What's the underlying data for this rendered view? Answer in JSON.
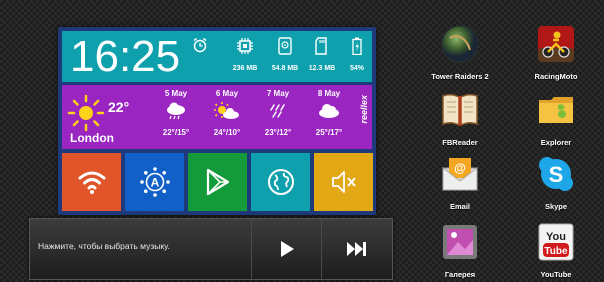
{
  "clock": {
    "time": "16:25"
  },
  "stats": [
    {
      "icon": "cpu-icon",
      "value": "236 MB"
    },
    {
      "icon": "sd-card-icon",
      "value": "54.8 MB"
    },
    {
      "icon": "memory-card-icon",
      "value": "12.3 MB"
    },
    {
      "icon": "battery-icon",
      "value": "54%"
    }
  ],
  "weather": {
    "current_temp": "22°",
    "city": "London",
    "brand": "reellex",
    "days": [
      {
        "date": "5 May",
        "range": "22°/15°",
        "icon": "cloud-rain-icon"
      },
      {
        "date": "6 May",
        "range": "24°/10°",
        "icon": "sun-cloud-icon"
      },
      {
        "date": "7 May",
        "range": "23°/12°",
        "icon": "rain-icon"
      },
      {
        "date": "8 May",
        "range": "25°/17°",
        "icon": "cloud-icon"
      }
    ]
  },
  "tiles": [
    {
      "name": "wifi-tile",
      "icon": "wifi-icon",
      "color": "#e0552a"
    },
    {
      "name": "auto-brightness-tile",
      "icon": "auto-brightness-icon",
      "color": "#1060c8"
    },
    {
      "name": "play-store-tile",
      "icon": "play-store-icon",
      "color": "#139a3a"
    },
    {
      "name": "browser-tile",
      "icon": "globe-icon",
      "color": "#0fa0ad"
    },
    {
      "name": "sound-tile",
      "icon": "mute-icon",
      "color": "#e3a816"
    }
  ],
  "player": {
    "prompt": "Нажмите, чтобы выбрать музыку."
  },
  "apps": [
    {
      "label": "Tower Raiders 2",
      "icon": "tower-raiders-icon"
    },
    {
      "label": "RacingMoto",
      "icon": "racing-moto-icon"
    },
    {
      "label": "FBReader",
      "icon": "book-icon"
    },
    {
      "label": "Explorer",
      "icon": "folder-icon"
    },
    {
      "label": "Email",
      "icon": "email-icon"
    },
    {
      "label": "Skype",
      "icon": "skype-icon"
    },
    {
      "label": "Галерея",
      "icon": "gallery-icon"
    },
    {
      "label": "YouTube",
      "icon": "youtube-icon"
    }
  ],
  "colors": {
    "clock": "#0fa0ad",
    "weather": "#9a25c0",
    "frame": "#1e3a7a",
    "sun": "#ffd21a"
  }
}
